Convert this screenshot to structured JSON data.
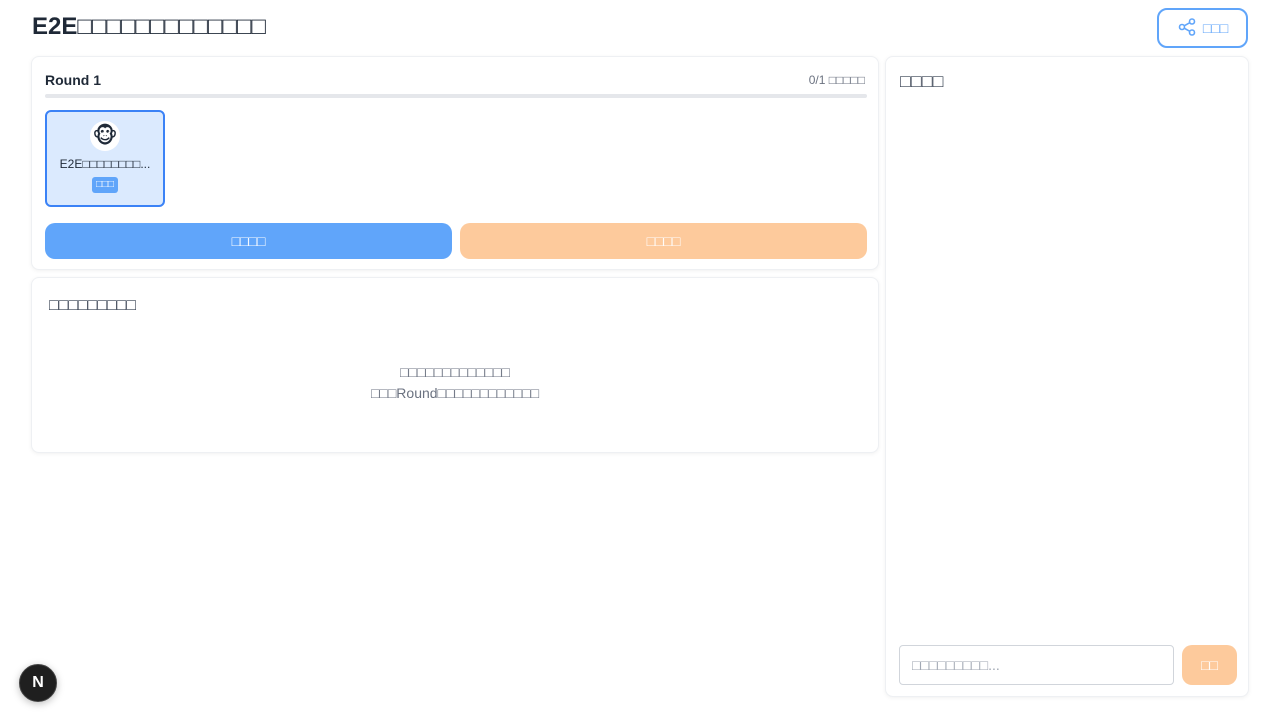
{
  "header": {
    "title": "E2E□□□□□□□□□□□□□",
    "share_label": "□□□"
  },
  "round": {
    "title": "Round 1",
    "progress_count": "0/1",
    "progress_label": "□□□□□",
    "progress_fraction": 0,
    "participant": {
      "avatar": "🐵",
      "name": "E2E□□□□□□□□...",
      "badge": "□□□"
    },
    "start_label": "□□□□",
    "end_label": "□□□□"
  },
  "results": {
    "title": "□□□□□□□□□",
    "empty_line1": "□□□□□□□□□□□□□",
    "empty_line2": "□□□Round□□□□□□□□□□□□"
  },
  "chat": {
    "title": "□□□□",
    "input_placeholder": "□□□□□□□□□...",
    "input_value": "",
    "send_label": "□□"
  },
  "dev_badge": {
    "label": "N"
  },
  "colors": {
    "primary": "#60a5fa",
    "accent_orange": "#fdca9c",
    "selected_bg": "#dbeafe"
  },
  "icons": {
    "share": "share-icon"
  }
}
